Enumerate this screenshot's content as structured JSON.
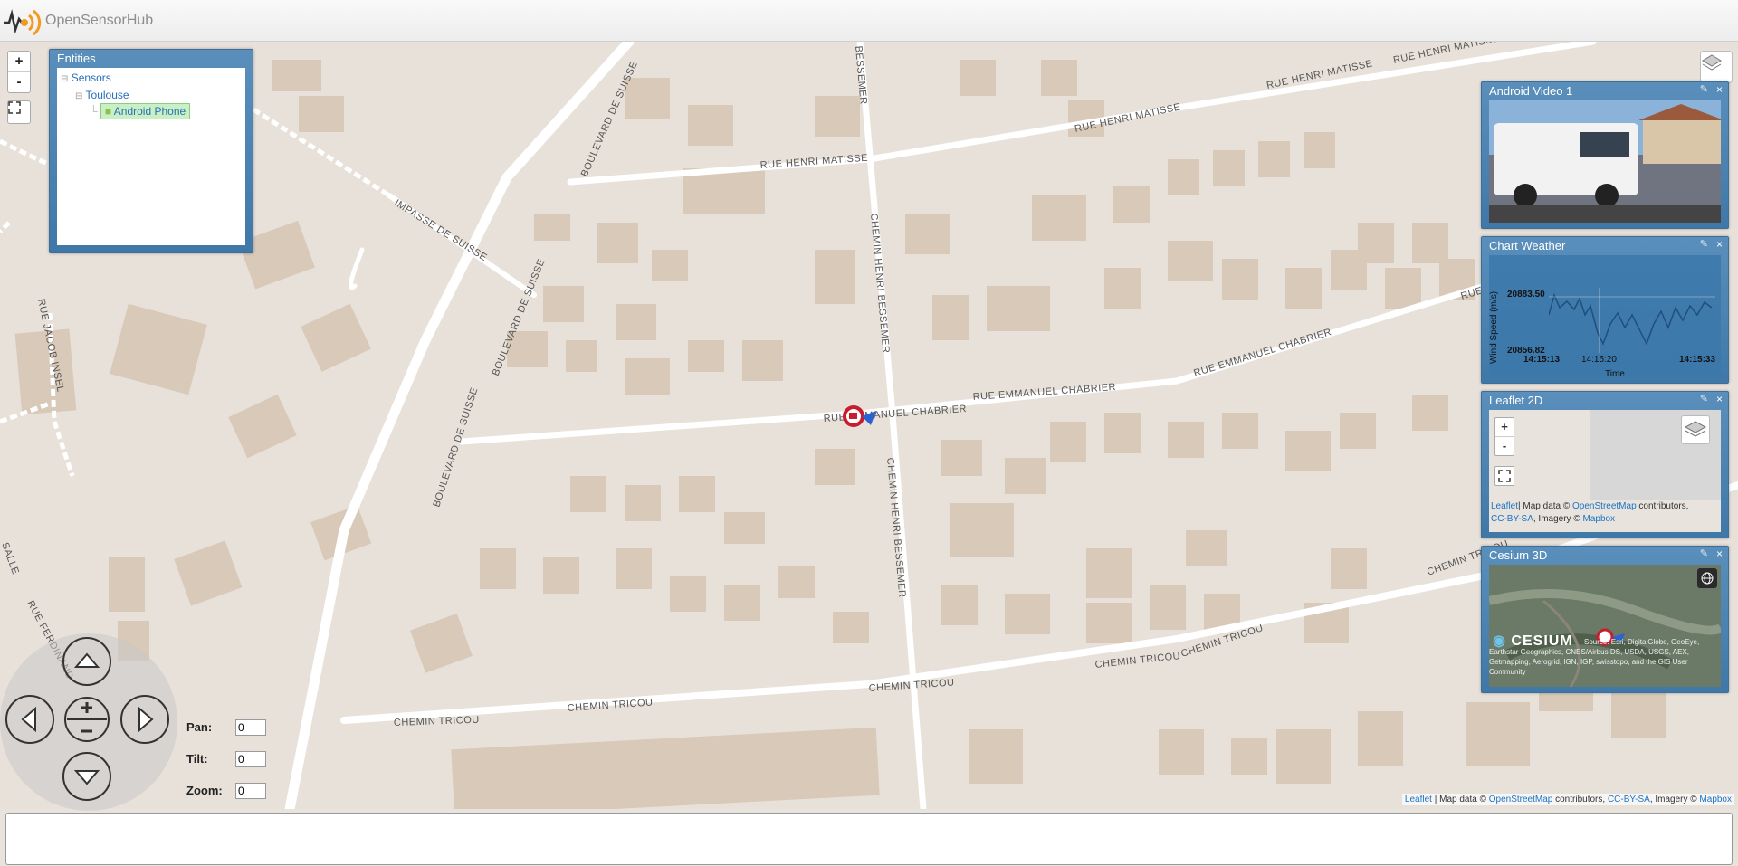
{
  "header": {
    "app_name": "OpenSensorHub"
  },
  "map": {
    "zoom_in": "+",
    "zoom_out": "-",
    "streets": {
      "boulevard_de_suisse": "BOULEVARD DE SUISSE",
      "impasse_de_suisse": "IMPASSE DE SUISSE",
      "rue_henri_matisse": "RUE HENRI MATISSE",
      "chemin_henri_bessemer": "CHEMIN HENRI BESSEMER",
      "rue_emmanuel_chabrier": "RUE EMMANUEL CHABRIER",
      "chemin_tricou": "CHEMIN TRICOU",
      "rue_jacob_insel": "RUE JACOB INSEL",
      "bessemer_short": "BESSEMER",
      "rue_ferdinand": "RUE FERDINAND",
      "salle": "SALLE",
      "rue_emmanuel_short": "RUE EMMANUEL"
    },
    "attribution": {
      "leaflet": "Leaflet",
      "sep1": " | Map data © ",
      "osm": "OpenStreetMap",
      "contrib": " contributors, ",
      "ccbysa": "CC-BY-SA",
      "imagery": ", Imagery © ",
      "mapbox": "Mapbox"
    }
  },
  "entities": {
    "title": "Entities",
    "tree": [
      {
        "label": "Sensors"
      },
      {
        "label": "Toulouse"
      },
      {
        "label": "Android Phone"
      }
    ]
  },
  "widgets": {
    "video": {
      "title": "Android Video 1"
    },
    "chart": {
      "title": "Chart Weather",
      "ylabel": "Wind Speed (m/s)",
      "xlabel": "Time",
      "ymax": "20883.50",
      "ymin": "20856.82",
      "t_start": "14:15:13",
      "t_mid": "14:15:20",
      "t_end": "14:15:33"
    },
    "leaflet2d": {
      "title": "Leaflet 2D",
      "zoom_in": "+",
      "zoom_out": "-",
      "attr_leaflet": "Leaflet",
      "attr_mid": "| Map data © ",
      "attr_osm": "OpenStreetMap",
      "attr_contrib": " contributors,",
      "attr_cc": "CC-BY-SA",
      "attr_imagery": ", Imagery © ",
      "attr_mapbox": "Mapbox"
    },
    "cesium": {
      "title": "Cesium 3D",
      "logo_text": "CESIUM",
      "credit": "Source: Esri, DigitalGlobe, GeoEye, Earthstar Geographics, CNES/Airbus DS, USDA, USGS, AEX, Getmapping, Aerogrid, IGN, IGP, swisstopo, and the GIS User Community"
    }
  },
  "nav_controls": {
    "pan_label": "Pan:",
    "tilt_label": "Tilt:",
    "zoom_label": "Zoom:",
    "pan_value": "0",
    "tilt_value": "0",
    "zoom_value": "0"
  }
}
